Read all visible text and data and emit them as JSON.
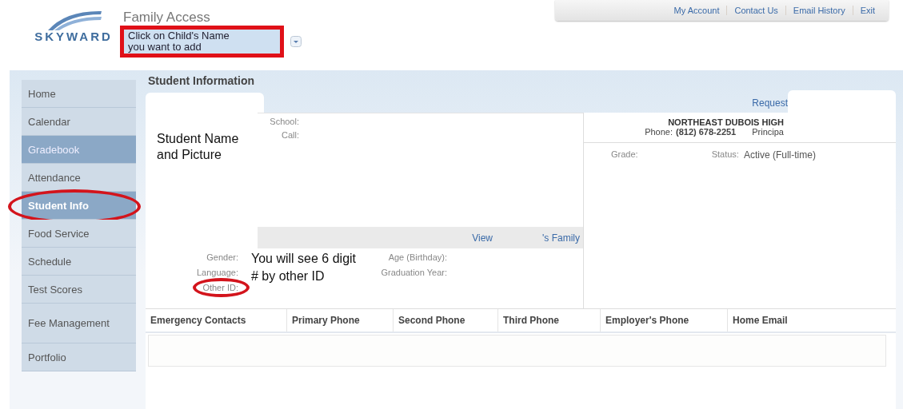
{
  "header": {
    "logo_text": "SKYWARD",
    "title": "Family Access",
    "child_selector": {
      "text": "Click on Child's Name you want to add",
      "marked": true
    }
  },
  "top_nav": [
    {
      "label": "My Account"
    },
    {
      "label": "Contact Us"
    },
    {
      "label": "Email History"
    },
    {
      "label": "Exit"
    }
  ],
  "sidebar": {
    "items": [
      {
        "label": "Home",
        "selected": false,
        "highlighted": false,
        "circled": false
      },
      {
        "label": "Calendar",
        "selected": false,
        "highlighted": false,
        "circled": false
      },
      {
        "label": "Gradebook",
        "selected": false,
        "highlighted": true,
        "circled": false
      },
      {
        "label": "Attendance",
        "selected": false,
        "highlighted": false,
        "circled": false
      },
      {
        "label": "Student Info",
        "selected": true,
        "highlighted": true,
        "circled": true
      },
      {
        "label": "Food Service",
        "selected": false,
        "highlighted": false,
        "circled": false
      },
      {
        "label": "Schedule",
        "selected": false,
        "highlighted": false,
        "circled": false
      },
      {
        "label": "Test Scores",
        "selected": false,
        "highlighted": false,
        "circled": false
      },
      {
        "label": "Fee Management",
        "selected": false,
        "highlighted": false,
        "circled": false
      },
      {
        "label": "Portfolio",
        "selected": false,
        "highlighted": false,
        "circled": false
      }
    ]
  },
  "page_title": "Student Information",
  "request_link": "Request",
  "photo_note": "Student Name and Picture",
  "school_fields": [
    {
      "label": "School:"
    },
    {
      "label": "Call:"
    }
  ],
  "family_links": [
    {
      "label": "View"
    },
    {
      "label": "'s Family"
    }
  ],
  "school": {
    "name": "NORTHEAST DUBOIS HIGH",
    "phone_label": "Phone:",
    "phone": "(812) 678-2251",
    "principal": "Principa"
  },
  "grade_label": "Grade:",
  "status_label": "Status:",
  "status_value": "Active (Full-time)",
  "demographics": {
    "labels": [
      {
        "label": "Gender:",
        "circled": false
      },
      {
        "label": "Language:",
        "circled": false
      },
      {
        "label": "Other ID:",
        "circled": true
      }
    ],
    "note": "You will see 6 digit # by other ID",
    "right_labels": [
      {
        "label": "Age (Birthday):"
      },
      {
        "label": "Graduation Year:"
      }
    ]
  },
  "table": {
    "columns": [
      "Emergency Contacts",
      "Primary Phone",
      "Second Phone",
      "Third Phone",
      "Employer's Phone",
      "Home Email"
    ]
  }
}
